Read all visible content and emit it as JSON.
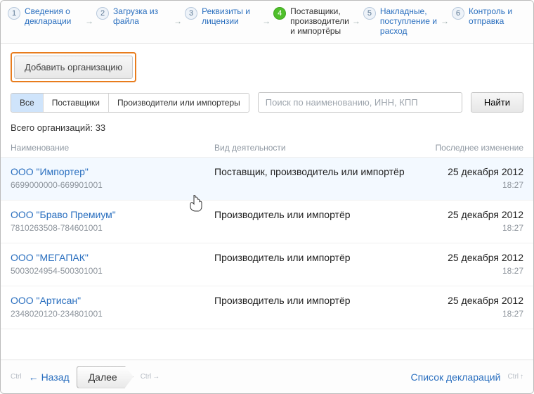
{
  "stepper": {
    "steps": [
      {
        "num": "1",
        "label": "Сведения о декларации"
      },
      {
        "num": "2",
        "label": "Загрузка из файла"
      },
      {
        "num": "3",
        "label": "Реквизиты и лицензии"
      },
      {
        "num": "4",
        "label": "Поставщики, производители и импортёры"
      },
      {
        "num": "5",
        "label": "Накладные, поступление и расход"
      },
      {
        "num": "6",
        "label": "Контроль и отправка"
      }
    ],
    "currentIndex": 3
  },
  "toolbar": {
    "add_label": "Добавить организацию",
    "filters": {
      "all": "Все",
      "suppliers": "Поставщики",
      "producers": "Производители или импортеры"
    },
    "search_placeholder": "Поиск по наименованию, ИНН, КПП",
    "find_label": "Найти"
  },
  "count": {
    "label": "Всего организаций:",
    "value": "33"
  },
  "columns": {
    "name": "Наименование",
    "activity": "Вид деятельности",
    "date": "Последнее изменение"
  },
  "rows": [
    {
      "name": "ООО \"Импортер\"",
      "code": "6699000000-669901001",
      "activity": "Поставщик, производитель или импортёр",
      "date": "25 декабря 2012",
      "time": "18:27",
      "hover": true
    },
    {
      "name": "ООО \"Браво Премиум\"",
      "code": "7810263508-784601001",
      "activity": "Производитель или импортёр",
      "date": "25 декабря 2012",
      "time": "18:27",
      "hover": false
    },
    {
      "name": "ООО \"МЕГАПАК\"",
      "code": "5003024954-500301001",
      "activity": "Производитель или импортёр",
      "date": "25 декабря 2012",
      "time": "18:27",
      "hover": false
    },
    {
      "name": "ООО \"Артисан\"",
      "code": "2348020120-234801001",
      "activity": "Производитель или импортёр",
      "date": "25 декабря 2012",
      "time": "18:27",
      "hover": false
    }
  ],
  "footer": {
    "ctrl_hint": "Ctrl",
    "back": "Назад",
    "next": "Далее",
    "list": "Список деклараций"
  }
}
